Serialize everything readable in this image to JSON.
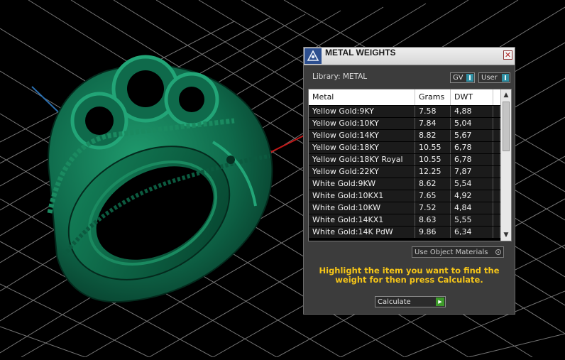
{
  "panel": {
    "title": "METAL WEIGHTS",
    "close_symbol": "✕",
    "library_label": "Library: METAL",
    "toggles": {
      "gv_label": "GV",
      "user_label": "User"
    },
    "table": {
      "columns": [
        "Metal",
        "Grams",
        "DWT"
      ],
      "rows": [
        {
          "metal": "Yellow Gold:9KY",
          "grams": "7.58",
          "dwt": "4,88"
        },
        {
          "metal": "Yellow Gold:10KY",
          "grams": "7.84",
          "dwt": "5,04"
        },
        {
          "metal": "Yellow Gold:14KY",
          "grams": "8.82",
          "dwt": "5,67"
        },
        {
          "metal": "Yellow Gold:18KY",
          "grams": "10.55",
          "dwt": "6,78"
        },
        {
          "metal": "Yellow Gold:18KY Royal",
          "grams": "10.55",
          "dwt": "6,78"
        },
        {
          "metal": "Yellow Gold:22KY",
          "grams": "12.25",
          "dwt": "7,87"
        },
        {
          "metal": "White Gold:9KW",
          "grams": "8.62",
          "dwt": "5,54"
        },
        {
          "metal": "White Gold:10KX1",
          "grams": "7.65",
          "dwt": "4,92"
        },
        {
          "metal": "White Gold:10KW",
          "grams": "7.52",
          "dwt": "4,84"
        },
        {
          "metal": "White Gold:14KX1",
          "grams": "8.63",
          "dwt": "5,55"
        },
        {
          "metal": "White Gold:14K PdW",
          "grams": "9.86",
          "dwt": "6,34"
        }
      ]
    },
    "use_object_materials_label": "Use Object Materials",
    "hint": "Highlight the item you want to find the weight for then press Calculate.",
    "calculate_label": "Calculate"
  },
  "colors": {
    "ring": "#0e6b4c",
    "grid": "#8a8a8a",
    "hint": "#f5c518",
    "axis_x": "#c01818",
    "axis_y": "#2a6fb0"
  }
}
